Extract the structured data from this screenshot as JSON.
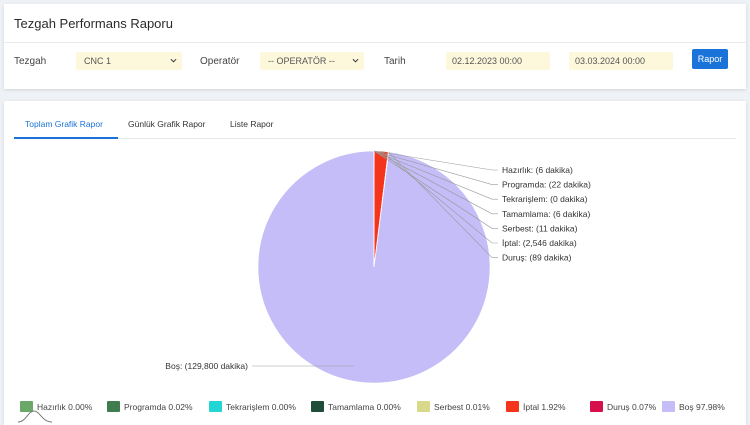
{
  "header": {
    "title": "Tezgah Performans Raporu"
  },
  "filters": {
    "machine_label": "Tezgah",
    "machine_value": "CNC 1",
    "operator_label": "Operatör",
    "operator_value": "-- OPERATÖR --",
    "date_label": "Tarih",
    "date_start": "02.12.2023 00:00",
    "date_end": "03.03.2024 00:00",
    "report_button": "Rapor"
  },
  "tabs": [
    {
      "label": "Toplam Grafik Rapor",
      "active": true
    },
    {
      "label": "Günlük Grafik Rapor",
      "active": false
    },
    {
      "label": "Liste Rapor",
      "active": false
    }
  ],
  "chart_data": {
    "type": "pie",
    "title": "",
    "series": [
      {
        "category": "Hazırlık",
        "minutes": 6,
        "percent": "0.00%",
        "color": "#6aa86a",
        "label": "Hazırlık: (6 dakika)"
      },
      {
        "category": "Programda",
        "minutes": 22,
        "percent": "0.02%",
        "color": "#3f7d4f",
        "label": "Programda: (22 dakika)"
      },
      {
        "category": "Tekrarişlem",
        "minutes": 0,
        "percent": "0.00%",
        "color": "#22d6d6",
        "label": "Tekrarişlem: (0 dakika)"
      },
      {
        "category": "Tamamlama",
        "minutes": 6,
        "percent": "0.00%",
        "color": "#1f4d3a",
        "label": "Tamamlama: (6 dakika)"
      },
      {
        "category": "Serbest",
        "minutes": 11,
        "percent": "0.01%",
        "color": "#d9d98c",
        "label": "Serbest: (11 dakika)"
      },
      {
        "category": "İptal",
        "minutes": 2546,
        "percent": "1.92%",
        "color": "#f5341c",
        "label": "İptal: (2,546 dakika)"
      },
      {
        "category": "Duruş",
        "minutes": 89,
        "percent": "0.07%",
        "color": "#d6104a",
        "label": "Duruş: (89 dakika)"
      },
      {
        "category": "Boş",
        "minutes": 129800,
        "percent": "97.98%",
        "color": "#c4bdf7",
        "label": "Boş: (129,800 dakika)"
      }
    ],
    "legend_position": "bottom"
  }
}
